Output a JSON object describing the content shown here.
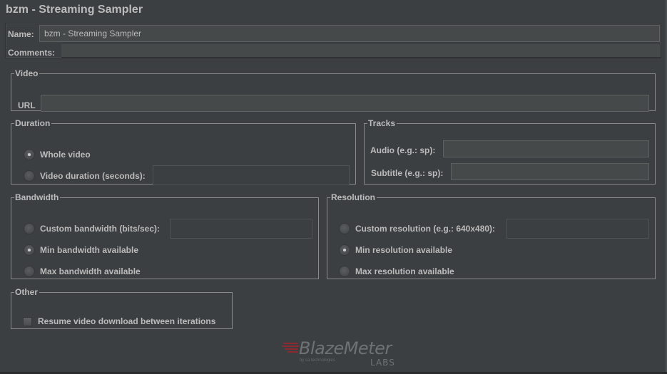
{
  "title": "bzm - Streaming Sampler",
  "name_panel": {
    "name_label": "Name:",
    "name_value": "bzm - Streaming Sampler",
    "comments_label": "Comments:",
    "comments_value": ""
  },
  "video": {
    "legend": "Video",
    "url_label": "URL",
    "url_value": ""
  },
  "duration": {
    "legend": "Duration",
    "options": [
      {
        "label": "Whole video",
        "checked": true
      },
      {
        "label": "Video duration (seconds):",
        "checked": false
      }
    ],
    "seconds_value": ""
  },
  "tracks": {
    "legend": "Tracks",
    "audio_label": "Audio (e.g.: sp):",
    "audio_value": "",
    "subtitle_label": "Subtitle (e.g.: sp):",
    "subtitle_value": ""
  },
  "bandwidth": {
    "legend": "Bandwidth",
    "options": [
      {
        "label": "Custom bandwidth (bits/sec):",
        "checked": false
      },
      {
        "label": "Min bandwidth available",
        "checked": true
      },
      {
        "label": "Max bandwidth available",
        "checked": false
      }
    ],
    "custom_value": ""
  },
  "resolution": {
    "legend": "Resolution",
    "options": [
      {
        "label": "Custom resolution (e.g.: 640x480):",
        "checked": false
      },
      {
        "label": "Min resolution available",
        "checked": true
      },
      {
        "label": "Max resolution available",
        "checked": false
      }
    ],
    "custom_value": ""
  },
  "other": {
    "legend": "Other",
    "resume_label": "Resume video download between iterations",
    "resume_checked": false
  },
  "logo": {
    "brand": "BlazeMeter",
    "byline": "by ca technologies",
    "sub": "LABS",
    "accent_color": "#8c2a31"
  }
}
